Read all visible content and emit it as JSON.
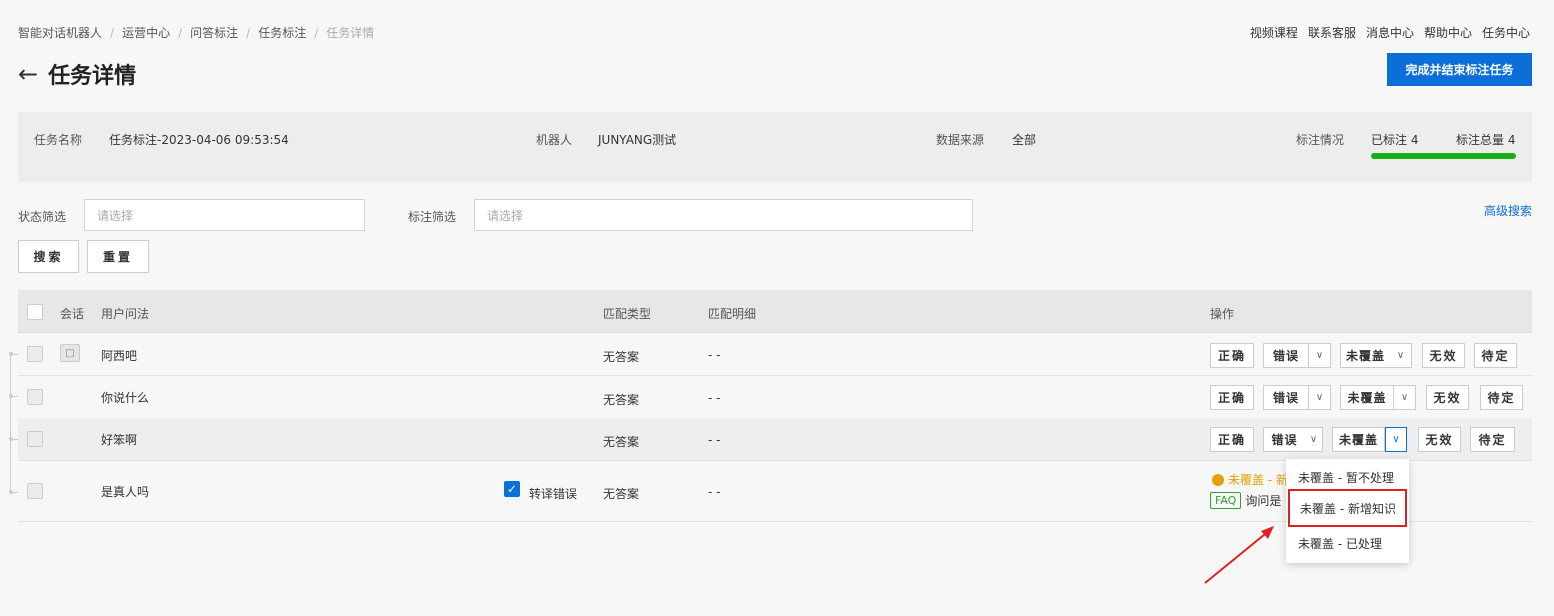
{
  "breadcrumb": [
    "智能对话机器人",
    "运营中心",
    "问答标注",
    "任务标注"
  ],
  "breadcrumb_current": "任务详情",
  "top_links": [
    "视频课程",
    "联系客服",
    "消息中心",
    "帮助中心",
    "任务中心"
  ],
  "page_title": "任务详情",
  "finish_button": "完成并结束标注任务",
  "info": {
    "task_name_label": "任务名称",
    "task_name": "任务标注-2023-04-06 09:53:54",
    "robot_label": "机器人",
    "robot": "JUNYANG测试",
    "source_label": "数据来源",
    "source": "全部",
    "status_label": "标注情况",
    "labeled": "已标注 4",
    "total": "标注总量 4",
    "progress": 1.0
  },
  "filters": {
    "status_label": "状态筛选",
    "status_placeholder": "请选择",
    "mark_label": "标注筛选",
    "mark_placeholder": "请选择",
    "advanced": "高级搜索",
    "search_btn": "搜索",
    "reset_btn": "重置"
  },
  "table": {
    "headers": {
      "session": "会话",
      "query": "用户问法",
      "match_type": "匹配类型",
      "match_detail": "匹配明细",
      "ops": "操作"
    },
    "rows": [
      {
        "query": "阿西吧",
        "match_type": "无答案",
        "match_detail": "- -"
      },
      {
        "query": "你说什么",
        "match_type": "无答案",
        "match_detail": "- -"
      },
      {
        "query": "好笨啊",
        "match_type": "无答案",
        "match_detail": "- -"
      },
      {
        "query": "是真人吗",
        "match_type": "无答案",
        "match_detail": "- -",
        "transfer_label": "转译错误"
      }
    ],
    "ops": {
      "correct": "正确",
      "wrong": "错误",
      "uncovered": "未覆盖",
      "invalid": "无效",
      "pending": "待定"
    },
    "row4_status": "未覆盖 - 新",
    "row4_faq_tag": "FAQ",
    "row4_faq_text": "询问是"
  },
  "dropdown_options": [
    "未覆盖 - 暂不处理",
    "未覆盖 - 新增知识",
    "未覆盖 - 已处理"
  ],
  "colors": {
    "primary": "#0b6fd7",
    "progress": "#19b016",
    "highlight_box": "#e02020",
    "warning": "#e5a000"
  }
}
